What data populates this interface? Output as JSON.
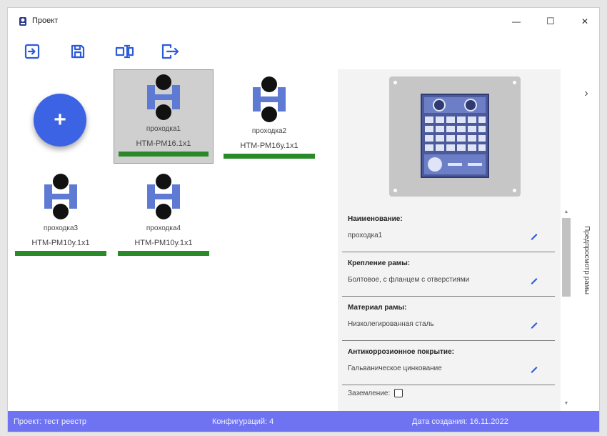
{
  "window": {
    "title": "Проект",
    "minimize_glyph": "—",
    "maximize_glyph": "☐",
    "close_glyph": "✕"
  },
  "toolbar": {
    "buttons": [
      {
        "icon": "import-icon"
      },
      {
        "icon": "save-icon"
      },
      {
        "icon": "export-icon"
      },
      {
        "icon": "exit-icon"
      }
    ],
    "accent": "#2d5bd8"
  },
  "canvas": {
    "add_label": "+",
    "nodes": [
      {
        "name": "проходка1",
        "model": "НТМ-РМ16.1x1",
        "selected": true
      },
      {
        "name": "проходка2",
        "model": "НТМ-РМ16у.1x1",
        "selected": false
      },
      {
        "name": "проходка3",
        "model": "НТМ-РМ10у.1x1",
        "selected": false
      },
      {
        "name": "проходка4",
        "model": "НТМ-РМ10у.1x1",
        "selected": false
      }
    ],
    "status_color": "#2a8a2a"
  },
  "properties": {
    "items": [
      {
        "label": "Наименование:",
        "value": "проходка1"
      },
      {
        "label": "Крепление рамы:",
        "value": "Болтовое, с фланцем с отверстиями"
      },
      {
        "label": "Материал рамы:",
        "value": "Низколегированная сталь"
      },
      {
        "label": "Антикоррозионное покрытие:",
        "value": "Гальваническое цинкование"
      }
    ],
    "grounding_label": "Заземление:",
    "grounding_checked": false
  },
  "side_panel": {
    "vertical_label": "Предпросмотр рамы",
    "chevron": "›"
  },
  "statusbar": {
    "project": "Проект: тест реестр",
    "configurations": "Конфигураций: 4",
    "created": "Дата создания: 16.11.2022",
    "color": "#6f73f2"
  }
}
